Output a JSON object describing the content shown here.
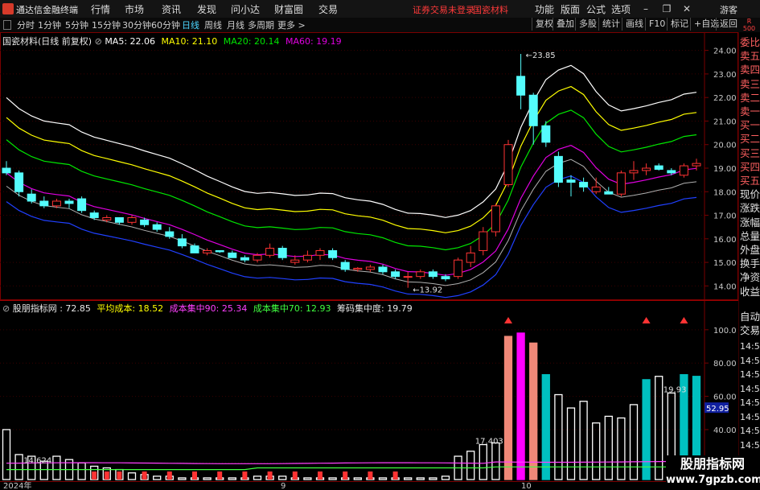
{
  "app": {
    "name": "通达信金融终端",
    "menu": [
      "行情",
      "市场",
      "资讯",
      "发现",
      "问小达",
      "财富圈",
      "交易"
    ],
    "notice_left": "证券交易未登录",
    "notice_right": "国瓷材料",
    "right_menu": [
      "功能",
      "版面",
      "公式",
      "选项"
    ],
    "guest": "游客",
    "window_buttons": [
      "minimize-icon",
      "restore-icon",
      "close-icon"
    ]
  },
  "toolbar": {
    "periods": [
      "分时",
      "1分钟",
      "5分钟",
      "15分钟",
      "30分钟",
      "60分钟",
      "日线",
      "周线",
      "月线",
      "多周期",
      "更多 >"
    ],
    "active": "日线",
    "right": [
      "复权",
      "叠加",
      "多股",
      "统计",
      "画线",
      "F10",
      "标记",
      "+自选",
      "返回"
    ]
  },
  "rscale": {
    "top": "R",
    "bottom": "500"
  },
  "side_panel": {
    "top_items": [
      "委比",
      "卖五",
      "卖四",
      "卖三",
      "卖二",
      "卖一",
      "买一",
      "买二",
      "买三",
      "买四",
      "买五",
      "现价",
      "涨跌",
      "涨幅",
      "总量",
      "外盘",
      "换手",
      "净资",
      "收益"
    ],
    "bottom_items": [
      "自动",
      "交易"
    ]
  },
  "main_legend": {
    "stock": "国瓷材料(日线 前复权)",
    "ma5": "MA5: 22.06",
    "ma10": "MA10: 21.10",
    "ma20": "MA20: 20.14",
    "ma60": "MA60: 19.19"
  },
  "sub_legend": {
    "name": "股朋指标网 : 72.85",
    "avg_cost": "平均成本: 18.52",
    "conc90": "成本集中90: 25.34",
    "conc70": "成本集中70: 12.93",
    "chip_conc": "筹码集中度: 19.79"
  },
  "colors": {
    "up": "#ff3333",
    "down": "#54fcfc",
    "ma5": "#ffffff",
    "ma10": "#ffff00",
    "ma20": "#00e600",
    "ma60": "#e000e0",
    "band_low": "#2040ff",
    "bar_white": "#ffffff",
    "bar_salmon": "#f08878",
    "bar_magenta": "#ff00ff",
    "bar_teal": "#00c0c0"
  },
  "chart_data": [
    {
      "type": "candlestick",
      "title": "国瓷材料(日线 前复权)",
      "ylim": [
        13.5,
        24.5
      ],
      "yticks": [
        14.0,
        15.0,
        16.0,
        17.0,
        18.0,
        19.0,
        20.0,
        21.0,
        22.0,
        23.0,
        24.0
      ],
      "annotations": [
        {
          "label": "23.85",
          "index": 41,
          "value": 23.85
        },
        {
          "label": "13.92",
          "index": 32,
          "value": 13.92
        }
      ],
      "ohlc": [
        [
          19.0,
          19.3,
          18.7,
          18.8
        ],
        [
          18.8,
          18.9,
          17.8,
          18.0
        ],
        [
          17.9,
          18.1,
          17.5,
          17.6
        ],
        [
          17.6,
          17.8,
          17.3,
          17.4
        ],
        [
          17.4,
          17.7,
          17.3,
          17.6
        ],
        [
          17.6,
          17.7,
          17.3,
          17.5
        ],
        [
          17.7,
          17.8,
          17.1,
          17.2
        ],
        [
          17.1,
          17.2,
          16.8,
          16.9
        ],
        [
          16.8,
          17.0,
          16.7,
          16.9
        ],
        [
          16.9,
          16.9,
          16.6,
          16.7
        ],
        [
          16.7,
          17.0,
          16.6,
          16.9
        ],
        [
          16.8,
          16.9,
          16.5,
          16.6
        ],
        [
          16.6,
          16.7,
          16.3,
          16.4
        ],
        [
          16.3,
          16.5,
          16.0,
          16.1
        ],
        [
          16.0,
          16.2,
          15.6,
          15.7
        ],
        [
          15.7,
          15.8,
          15.4,
          15.4
        ],
        [
          15.4,
          15.6,
          15.3,
          15.5
        ],
        [
          15.5,
          15.5,
          15.4,
          15.45
        ],
        [
          15.4,
          15.5,
          15.2,
          15.2
        ],
        [
          15.2,
          15.3,
          15.0,
          15.1
        ],
        [
          15.1,
          15.4,
          15.0,
          15.3
        ],
        [
          15.3,
          15.8,
          15.2,
          15.6
        ],
        [
          15.6,
          15.7,
          15.1,
          15.2
        ],
        [
          15.0,
          15.3,
          14.9,
          15.1
        ],
        [
          15.1,
          15.5,
          15.0,
          15.3
        ],
        [
          15.3,
          15.6,
          15.1,
          15.5
        ],
        [
          15.5,
          15.6,
          15.1,
          15.2
        ],
        [
          15.0,
          15.1,
          14.6,
          14.7
        ],
        [
          14.7,
          14.8,
          14.6,
          14.75
        ],
        [
          14.7,
          14.9,
          14.6,
          14.8
        ],
        [
          14.8,
          14.9,
          14.5,
          14.6
        ],
        [
          14.6,
          14.7,
          14.3,
          14.4
        ],
        [
          14.4,
          14.6,
          13.92,
          14.4
        ],
        [
          14.4,
          14.7,
          14.3,
          14.6
        ],
        [
          14.6,
          14.7,
          14.3,
          14.4
        ],
        [
          14.4,
          14.5,
          14.2,
          14.3
        ],
        [
          14.4,
          15.2,
          14.3,
          15.1
        ],
        [
          15.0,
          15.7,
          14.8,
          15.4
        ],
        [
          15.5,
          16.5,
          15.3,
          16.3
        ],
        [
          16.3,
          17.5,
          16.1,
          17.4
        ],
        [
          18.3,
          20.2,
          18.2,
          20.0
        ],
        [
          22.9,
          23.85,
          21.5,
          22.1
        ],
        [
          22.1,
          22.2,
          20.0,
          20.8
        ],
        [
          20.8,
          21.0,
          19.9,
          20.1
        ],
        [
          19.5,
          19.7,
          18.2,
          18.4
        ],
        [
          18.5,
          18.7,
          17.8,
          18.4
        ],
        [
          18.4,
          18.6,
          18.0,
          18.2
        ],
        [
          18.0,
          18.6,
          17.9,
          18.2
        ],
        [
          18.0,
          18.2,
          17.9,
          17.9
        ],
        [
          17.9,
          18.9,
          17.8,
          18.8
        ],
        [
          18.8,
          19.3,
          18.5,
          18.9
        ],
        [
          18.9,
          19.2,
          18.7,
          19.0
        ],
        [
          19.1,
          19.2,
          18.9,
          18.95
        ],
        [
          18.9,
          19.0,
          18.7,
          18.8
        ],
        [
          18.7,
          19.2,
          18.6,
          19.1
        ],
        [
          19.1,
          19.4,
          18.9,
          19.2
        ]
      ]
    },
    {
      "type": "bar",
      "title": "股朋指标网",
      "ylim": [
        10,
        112
      ],
      "yticks": [
        20.0,
        40.0,
        60.0,
        80.0,
        100.0
      ],
      "annotations": [
        {
          "label": "14.624",
          "index": 2
        },
        {
          "label": "17.403",
          "index": 38
        },
        {
          "label": "19.93",
          "index": 53
        },
        {
          "label": "52.95",
          "axis": true
        }
      ],
      "values": [
        40,
        25,
        24,
        21,
        24,
        22,
        20,
        18,
        17,
        16,
        14,
        13,
        12,
        12,
        11,
        11,
        11,
        11,
        11,
        11,
        12,
        12,
        12,
        11,
        11,
        11,
        11,
        11,
        11,
        11,
        11,
        11,
        11,
        11,
        11,
        12,
        24,
        27,
        31,
        32,
        96,
        98,
        92,
        73,
        61,
        53,
        57,
        44,
        48,
        47,
        55,
        70,
        72,
        62,
        73,
        72
      ],
      "colors": [
        "w",
        "w",
        "w",
        "w",
        "w",
        "w",
        "w",
        "w",
        "w",
        "w",
        "w",
        "w",
        "w",
        "w",
        "w",
        "w",
        "w",
        "w",
        "w",
        "w",
        "w",
        "w",
        "w",
        "w",
        "w",
        "w",
        "w",
        "w",
        "w",
        "w",
        "w",
        "w",
        "w",
        "w",
        "w",
        "w",
        "w",
        "w",
        "w",
        "w",
        "s",
        "m",
        "s",
        "t",
        "w",
        "w",
        "w",
        "w",
        "w",
        "w",
        "w",
        "t",
        "w",
        "w",
        "t",
        "t"
      ],
      "lines": {
        "magenta": 19.8,
        "green": 17.0
      }
    }
  ]
}
